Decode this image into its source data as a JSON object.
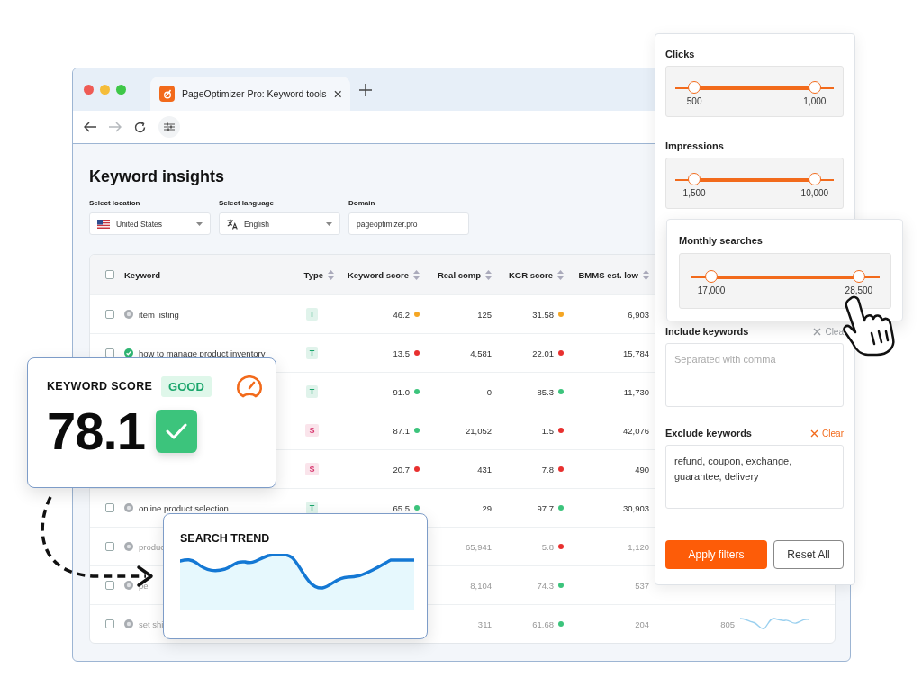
{
  "browser": {
    "tab_title": "PageOptimizer Pro: Keyword tools",
    "forward_disabled": true
  },
  "page": {
    "title": "Keyword insights",
    "fields": [
      {
        "kind": "location",
        "label": "Select location",
        "value": "United States"
      },
      {
        "kind": "language",
        "label": "Select language",
        "value": "English"
      },
      {
        "kind": "text",
        "label": "Domain",
        "value": "pageoptimizer.pro"
      }
    ]
  },
  "table": {
    "select_all_checked": false,
    "columns": [
      {
        "label": "Keyword",
        "sortable": false
      },
      {
        "label": "Type",
        "sortable": true
      },
      {
        "label": "Keyword score",
        "sortable": true
      },
      {
        "label": "Real comp",
        "sortable": true
      },
      {
        "label": "KGR score",
        "sortable": true
      },
      {
        "label": "BMMS est. low",
        "sortable": true
      }
    ],
    "rows": [
      {
        "checked": false,
        "completed": false,
        "keyword": "item listing",
        "type": {
          "label": "T",
          "color": "#1aa56b"
        },
        "keyword_score": {
          "value": "46.2",
          "color": "#f5a623"
        },
        "real_comp": "125",
        "kgr_score": {
          "value": "31.58",
          "color": "#f5a623"
        },
        "bmms_est_low": "6,903"
      },
      {
        "checked": false,
        "completed": true,
        "keyword": "how to manage product inventory",
        "type": {
          "label": "T",
          "color": "#1aa56b"
        },
        "keyword_score": {
          "value": "13.5",
          "color": "#e8302f"
        },
        "real_comp": "4,581",
        "kgr_score": {
          "value": "22.01",
          "color": "#e8302f"
        },
        "bmms_est_low": "15,784"
      },
      {
        "type": {
          "label": "T",
          "color": "#1aa56b"
        },
        "keyword_score": {
          "value": "91.0",
          "color": "#3cc47c"
        },
        "real_comp": "0",
        "kgr_score": {
          "value": "85.3",
          "color": "#3cc47c"
        },
        "bmms_est_low": "11,730"
      },
      {
        "type": {
          "label": "S",
          "color": "#d6336c"
        },
        "keyword_score": {
          "value": "87.1",
          "color": "#3cc47c"
        },
        "real_comp": "21,052",
        "kgr_score": {
          "value": "1.5",
          "color": "#e8302f"
        },
        "bmms_est_low": "42,076"
      },
      {
        "type": {
          "label": "S",
          "color": "#d6336c"
        },
        "keyword_score": {
          "value": "20.7",
          "color": "#e8302f"
        },
        "real_comp": "431",
        "kgr_score": {
          "value": "7.8",
          "color": "#e8302f"
        },
        "bmms_est_low": "490"
      },
      {
        "checked": false,
        "completed": false,
        "keyword": "online product selection",
        "type": {
          "label": "T",
          "color": "#1aa56b"
        },
        "keyword_score": {
          "value": "65.5",
          "color": "#3cc47c"
        },
        "real_comp": "29",
        "kgr_score": {
          "value": "97.7",
          "color": "#3cc47c"
        },
        "bmms_est_low": "30,903"
      },
      {
        "checked": false,
        "completed": false,
        "keyword": "produc",
        "real_comp": "65,941",
        "kgr_score": {
          "value": "5.8",
          "color": "#e8302f"
        },
        "bmms_est_low": "1,120"
      },
      {
        "checked": false,
        "completed": false,
        "keyword": "pe",
        "real_comp": "8,104",
        "kgr_score": {
          "value": "74.3",
          "color": "#3cc47c"
        },
        "bmms_est_low": "537"
      },
      {
        "checked": false,
        "completed": false,
        "keyword": "set shi",
        "real_comp": "311",
        "kgr_score": {
          "value": "61.68",
          "color": "#3cc47c"
        },
        "bmms_est_low": "204",
        "column_7": "805",
        "sparkline": true
      }
    ]
  },
  "score_card": {
    "title": "KEYWORD SCORE",
    "badge": "GOOD",
    "value": "78.1"
  },
  "trend_card": {
    "title": "SEARCH TREND"
  },
  "filters": {
    "sliders": [
      {
        "label": "Clicks",
        "raised": false,
        "thumbs": [
          {
            "level": 0.12,
            "reading": "500"
          },
          {
            "level": 0.88,
            "reading": "1,000"
          }
        ]
      },
      {
        "label": "Impressions",
        "raised": false,
        "thumbs": [
          {
            "level": 0.12,
            "reading": "1,500"
          },
          {
            "level": 0.88,
            "reading": "10,000"
          }
        ]
      },
      {
        "label": "Monthly searches",
        "raised": true,
        "thumbs": [
          {
            "level": 0.11,
            "reading": "17,000"
          },
          {
            "level": 0.89,
            "reading": "28,500"
          }
        ]
      }
    ],
    "include": {
      "label": "Include keywords",
      "clear": {
        "label": "Clea",
        "disabled": true
      },
      "placeholder": "Separated with comma"
    },
    "exclude": {
      "label": "Exclude keywords",
      "clear": {
        "label": "Clear",
        "disabled": false
      },
      "value": "refund, coupon, exchange, guarantee, delivery"
    },
    "buttons": [
      {
        "label": "Apply filters",
        "kind": "primary"
      },
      {
        "label": "Reset All",
        "kind": "secondary"
      }
    ]
  }
}
